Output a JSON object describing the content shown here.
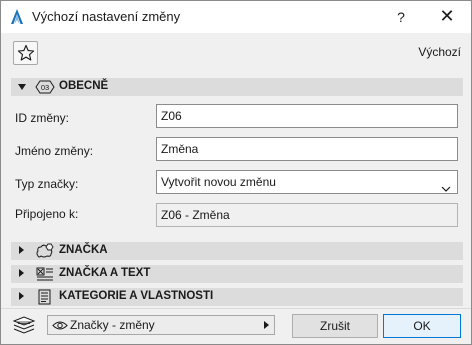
{
  "window": {
    "title": "Výchozí nastavení změny",
    "help_label": "?",
    "close_label": "✕"
  },
  "toolbar": {
    "default_label": "Výchozí"
  },
  "sections": {
    "general": {
      "label": "OBECNĚ",
      "badge": "03",
      "expanded": true
    },
    "marker": {
      "label": "ZNAČKA",
      "expanded": false
    },
    "marker_text": {
      "label": "ZNAČKA A TEXT",
      "expanded": false
    },
    "categories": {
      "label": "KATEGORIE A VLASTNOSTI",
      "expanded": false
    }
  },
  "fields": {
    "change_id": {
      "label": "ID změny:",
      "value": "Z06"
    },
    "change_name": {
      "label": "Jméno změny:",
      "value": "Změna"
    },
    "marker_type": {
      "label": "Typ značky:",
      "value": "Vytvořit novou změnu"
    },
    "linked_to": {
      "label": "Připojeno k:",
      "value": "Z06 - Změna"
    }
  },
  "footer": {
    "layer_dropdown": "Značky - změny",
    "cancel_label": "Zrušit",
    "ok_label": "OK"
  },
  "colors": {
    "accent": "#0078d7",
    "section_bg": "#dcdcdc",
    "dialog_bg": "#f0f0f0"
  }
}
